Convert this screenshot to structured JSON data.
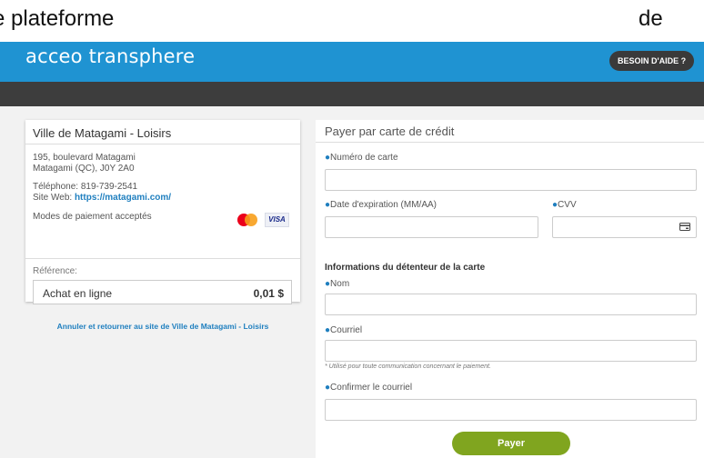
{
  "caption": {
    "left_text": "e plateforme",
    "right_text": "de"
  },
  "header": {
    "logo_text": "acceo transphere",
    "help_label": "BESOIN D'AIDE ?",
    "brand_color": "#1f93d2",
    "dark_bar_color": "#3d3d3d"
  },
  "merchant": {
    "name": "Ville de Matagami - Loisirs",
    "address_line1": "195, boulevard Matagami",
    "address_line2": "Matagami (QC), J0Y 2A0",
    "phone_label": "Téléphone: 819-739-2541",
    "web_label": "Site Web:",
    "web_url": "https://matagami.com/",
    "payment_modes_label": "Modes de paiement acceptés",
    "card_icons": [
      "mastercard-icon",
      "visa-icon"
    ],
    "visa_text": "VISA"
  },
  "order": {
    "reference_label": "Référence:",
    "item_name": "Achat en ligne",
    "item_price": "0,01 $"
  },
  "cancel_link": "Annuler et retourner au site de Ville de Matagami - Loisirs",
  "form": {
    "title": "Payer par carte de crédit",
    "required_marker": "●",
    "card_number_label": "Numéro de carte",
    "card_number_value": "",
    "expiry_label": "Date d'expiration (MM/AA)",
    "expiry_value": "",
    "cvv_label": "CVV",
    "cvv_value": "",
    "holder_section": "Informations du détenteur de la carte",
    "name_label": "Nom",
    "name_value": "",
    "email_label": "Courriel",
    "email_value": "",
    "email_note": "* Utilisé pour toute communication concernant le paiement.",
    "confirm_email_label": "Confirmer le courriel",
    "confirm_email_value": "",
    "pay_label": "Payer",
    "accent_color": "#80a51f"
  }
}
